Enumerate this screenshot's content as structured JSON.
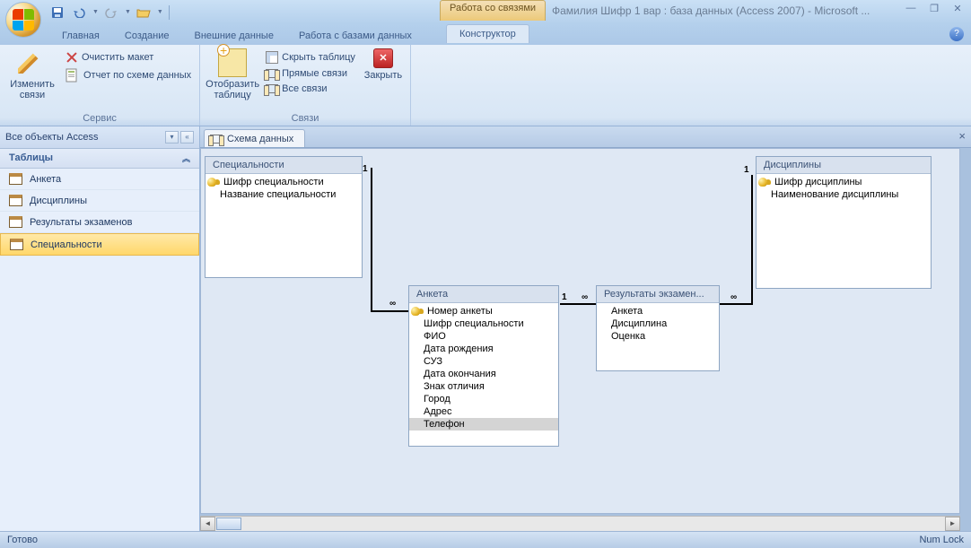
{
  "titlebar": {
    "context_tab_label": "Работа со связями",
    "title": "Фамилия Шифр 1 вар : база данных (Access 2007) - Microsoft ..."
  },
  "tabs": {
    "t1": "Главная",
    "t2": "Создание",
    "t3": "Внешние данные",
    "t4": "Работа с базами данных",
    "context": "Конструктор"
  },
  "ribbon": {
    "group1": {
      "label": "Сервис",
      "edit_rel": "Изменить\nсвязи",
      "clear": "Очистить макет",
      "report": "Отчет по схеме данных"
    },
    "group2": {
      "label": "Связи",
      "show_table": "Отобразить\nтаблицу",
      "hide_table": "Скрыть таблицу",
      "direct": "Прямые связи",
      "all": "Все связи",
      "close": "Закрыть"
    }
  },
  "navpane": {
    "header": "Все объекты Access",
    "section": "Таблицы",
    "items": [
      "Анкета",
      "Дисциплины",
      "Результаты экзаменов",
      "Специальности"
    ],
    "selected_index": 3
  },
  "doc": {
    "tab": "Схема данных"
  },
  "tables": {
    "spec": {
      "title": "Специальности",
      "fields": [
        "Шифр специальности",
        "Название специальности"
      ],
      "key_idx": [
        0
      ]
    },
    "anketa": {
      "title": "Анкета",
      "fields": [
        "Номер анкеты",
        "Шифр специальности",
        "ФИО",
        "Дата рождения",
        "СУЗ",
        "Дата окончания",
        "Знак отличия",
        "Город",
        "Адрес",
        "Телефон"
      ],
      "key_idx": [
        0
      ],
      "selected_idx": [
        9
      ]
    },
    "results": {
      "title": "Результаты экзамен...",
      "fields": [
        "Анкета",
        "Дисциплина",
        "Оценка"
      ],
      "key_idx": []
    },
    "disc": {
      "title": "Дисциплины",
      "fields": [
        "Шифр дисциплины",
        "Наименование дисциплины"
      ],
      "key_idx": [
        0
      ]
    }
  },
  "rel": {
    "one": "1",
    "many": "∞"
  },
  "statusbar": {
    "ready": "Готово",
    "numlock": "Num Lock"
  }
}
